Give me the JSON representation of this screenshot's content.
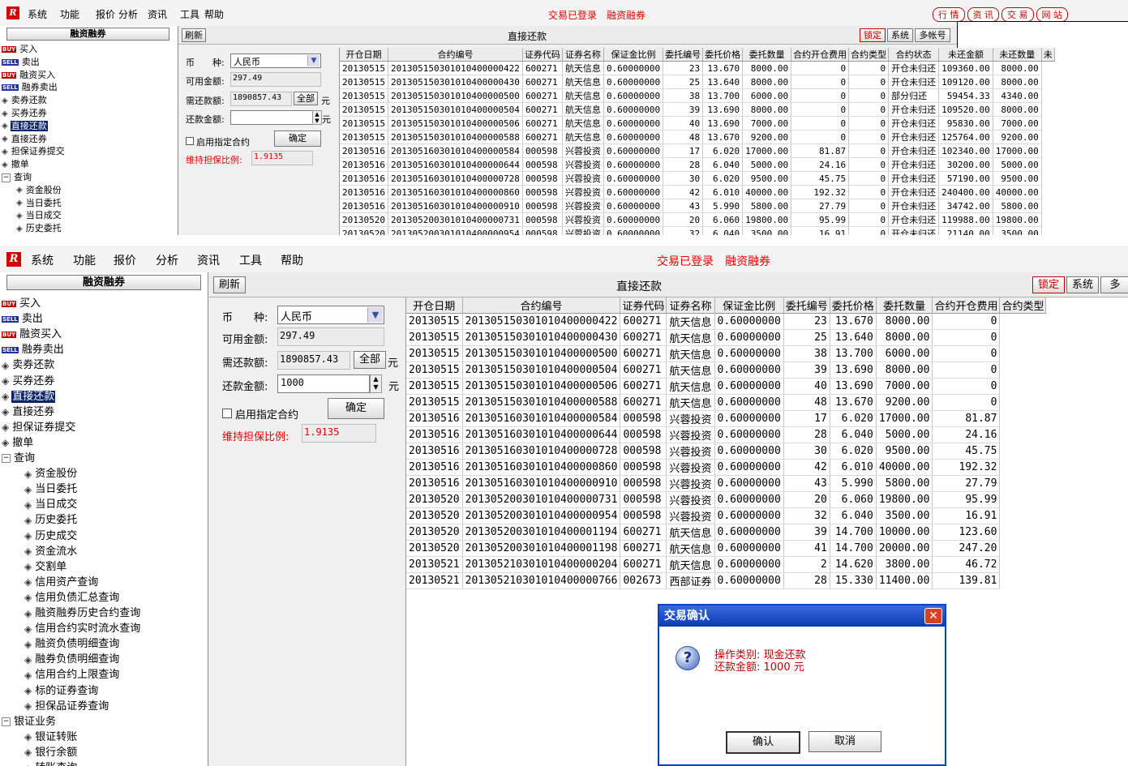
{
  "menu": {
    "logo": "R",
    "items": [
      "系统",
      "功能",
      "报价",
      "分析",
      "资讯",
      "工具",
      "帮助"
    ],
    "status": "交易已登录　融资融券",
    "top_buttons": [
      "行 情",
      "资 讯",
      "交 易",
      "网 站"
    ]
  },
  "sidebar": {
    "title": "融资融券",
    "items": [
      {
        "icon": "buy-icon",
        "badge": "BUY",
        "label": "买入"
      },
      {
        "icon": "sell-icon",
        "badge": "SELL",
        "label": "卖出"
      },
      {
        "icon": "buy-icon",
        "badge": "BUY",
        "label": "融资买入"
      },
      {
        "icon": "sell-icon",
        "badge": "SELL",
        "label": "融券卖出"
      },
      {
        "icon": "diamond-icon",
        "label": "卖券还款"
      },
      {
        "icon": "diamond-icon",
        "label": "买券还券"
      },
      {
        "icon": "diamond-icon",
        "label": "直接还款",
        "selected": true
      },
      {
        "icon": "diamond-icon",
        "label": "直接还券"
      },
      {
        "icon": "diamond-icon",
        "label": "担保证券提交"
      },
      {
        "icon": "diamond-icon",
        "label": "撤单"
      },
      {
        "icon": "collapse-icon",
        "label": "查询",
        "expander": "−"
      },
      {
        "icon": "diamond-icon",
        "label": "资金股份",
        "indent": true
      },
      {
        "icon": "diamond-icon",
        "label": "当日委托",
        "indent": true
      },
      {
        "icon": "diamond-icon",
        "label": "当日成交",
        "indent": true
      },
      {
        "icon": "diamond-icon",
        "label": "历史委托",
        "indent": true
      },
      {
        "icon": "diamond-icon",
        "label": "历史成交",
        "indent": true
      },
      {
        "icon": "diamond-icon",
        "label": "资金流水",
        "indent": true
      },
      {
        "icon": "diamond-icon",
        "label": "交割单",
        "indent": true
      },
      {
        "icon": "diamond-icon",
        "label": "信用资产查询",
        "indent": true
      },
      {
        "icon": "diamond-icon",
        "label": "信用负债汇总查询",
        "indent": true
      },
      {
        "icon": "diamond-icon",
        "label": "融资融券历史合约查询",
        "indent": true
      },
      {
        "icon": "diamond-icon",
        "label": "信用合约实时流水查询",
        "indent": true
      },
      {
        "icon": "diamond-icon",
        "label": "融资负债明细查询",
        "indent": true
      },
      {
        "icon": "diamond-icon",
        "label": "融券负债明细查询",
        "indent": true
      },
      {
        "icon": "diamond-icon",
        "label": "信用合约上限查询",
        "indent": true
      },
      {
        "icon": "diamond-icon",
        "label": "标的证券查询",
        "indent": true
      },
      {
        "icon": "diamond-icon",
        "label": "担保品证券查询",
        "indent": true
      },
      {
        "icon": "collapse-icon",
        "label": "银证业务",
        "expander": "−"
      },
      {
        "icon": "diamond-icon",
        "label": "银证转账",
        "indent": true
      },
      {
        "icon": "diamond-icon",
        "label": "银行余额",
        "indent": true
      },
      {
        "icon": "diamond-icon",
        "label": "转账查询",
        "indent": true
      }
    ]
  },
  "toolbar": {
    "refresh": "刷新",
    "title": "直接还款",
    "right_buttons": [
      "锁定",
      "系统",
      "多帐号"
    ],
    "right_buttons_cut": [
      "锁定",
      "系统",
      "多"
    ]
  },
  "form": {
    "currency_label": "币　　种:",
    "currency_value": "人民币",
    "available_label": "可用金额:",
    "available_value": "297.49",
    "need_label": "需还款额:",
    "need_value": "1890857.43",
    "all_button": "全部",
    "unit": "元",
    "repay_label": "还款金额:",
    "repay_value_top": "",
    "repay_value_bottom": "1000",
    "specify_label": "启用指定合约",
    "confirm_button": "确定",
    "ratio_label": "维持担保比例:",
    "ratio_value": "1.9135"
  },
  "table_top": {
    "headers": [
      "开仓日期",
      "合约编号",
      "证券代码",
      "证券名称",
      "保证金比例",
      "委托编号",
      "委托价格",
      "委托数量",
      "合约开仓费用",
      "合约类型",
      "合约状态",
      "未还金额",
      "未还数量",
      "未"
    ],
    "rows": [
      [
        "20130515",
        "201305150301010400000422",
        "600271",
        "航天信息",
        "0.60000000",
        "23",
        "13.670",
        "8000.00",
        "0",
        "0",
        "开仓未归还",
        "109360.00",
        "8000.00"
      ],
      [
        "20130515",
        "201305150301010400000430",
        "600271",
        "航天信息",
        "0.60000000",
        "25",
        "13.640",
        "8000.00",
        "0",
        "0",
        "开仓未归还",
        "109120.00",
        "8000.00"
      ],
      [
        "20130515",
        "201305150301010400000500",
        "600271",
        "航天信息",
        "0.60000000",
        "38",
        "13.700",
        "6000.00",
        "0",
        "0",
        "部分归还",
        "59454.33",
        "4340.00"
      ],
      [
        "20130515",
        "201305150301010400000504",
        "600271",
        "航天信息",
        "0.60000000",
        "39",
        "13.690",
        "8000.00",
        "0",
        "0",
        "开仓未归还",
        "109520.00",
        "8000.00"
      ],
      [
        "20130515",
        "201305150301010400000506",
        "600271",
        "航天信息",
        "0.60000000",
        "40",
        "13.690",
        "7000.00",
        "0",
        "0",
        "开仓未归还",
        "95830.00",
        "7000.00"
      ],
      [
        "20130515",
        "201305150301010400000588",
        "600271",
        "航天信息",
        "0.60000000",
        "48",
        "13.670",
        "9200.00",
        "0",
        "0",
        "开仓未归还",
        "125764.00",
        "9200.00"
      ],
      [
        "20130516",
        "201305160301010400000584",
        "000598",
        "兴蓉投资",
        "0.60000000",
        "17",
        "6.020",
        "17000.00",
        "81.87",
        "0",
        "开仓未归还",
        "102340.00",
        "17000.00"
      ],
      [
        "20130516",
        "201305160301010400000644",
        "000598",
        "兴蓉投资",
        "0.60000000",
        "28",
        "6.040",
        "5000.00",
        "24.16",
        "0",
        "开仓未归还",
        "30200.00",
        "5000.00"
      ],
      [
        "20130516",
        "201305160301010400000728",
        "000598",
        "兴蓉投资",
        "0.60000000",
        "30",
        "6.020",
        "9500.00",
        "45.75",
        "0",
        "开仓未归还",
        "57190.00",
        "9500.00"
      ],
      [
        "20130516",
        "201305160301010400000860",
        "000598",
        "兴蓉投资",
        "0.60000000",
        "42",
        "6.010",
        "40000.00",
        "192.32",
        "0",
        "开仓未归还",
        "240400.00",
        "40000.00"
      ],
      [
        "20130516",
        "201305160301010400000910",
        "000598",
        "兴蓉投资",
        "0.60000000",
        "43",
        "5.990",
        "5800.00",
        "27.79",
        "0",
        "开仓未归还",
        "34742.00",
        "5800.00"
      ],
      [
        "20130520",
        "201305200301010400000731",
        "000598",
        "兴蓉投资",
        "0.60000000",
        "20",
        "6.060",
        "19800.00",
        "95.99",
        "0",
        "开仓未归还",
        "119988.00",
        "19800.00"
      ],
      [
        "20130520",
        "201305200301010400000954",
        "000598",
        "兴蓉投资",
        "0.60000000",
        "32",
        "6.040",
        "3500.00",
        "16.91",
        "0",
        "开仓未归还",
        "21140.00",
        "3500.00"
      ]
    ]
  },
  "table_bottom": {
    "headers": [
      "开仓日期",
      "合约编号",
      "证券代码",
      "证券名称",
      "保证金比例",
      "委托编号",
      "委托价格",
      "委托数量",
      "合约开仓费用",
      "合约类型"
    ],
    "rows": [
      [
        "20130515",
        "201305150301010400000422",
        "600271",
        "航天信息",
        "0.60000000",
        "23",
        "13.670",
        "8000.00",
        "0"
      ],
      [
        "20130515",
        "201305150301010400000430",
        "600271",
        "航天信息",
        "0.60000000",
        "25",
        "13.640",
        "8000.00",
        "0"
      ],
      [
        "20130515",
        "201305150301010400000500",
        "600271",
        "航天信息",
        "0.60000000",
        "38",
        "13.700",
        "6000.00",
        "0"
      ],
      [
        "20130515",
        "201305150301010400000504",
        "600271",
        "航天信息",
        "0.60000000",
        "39",
        "13.690",
        "8000.00",
        "0"
      ],
      [
        "20130515",
        "201305150301010400000506",
        "600271",
        "航天信息",
        "0.60000000",
        "40",
        "13.690",
        "7000.00",
        "0"
      ],
      [
        "20130515",
        "201305150301010400000588",
        "600271",
        "航天信息",
        "0.60000000",
        "48",
        "13.670",
        "9200.00",
        "0"
      ],
      [
        "20130516",
        "201305160301010400000584",
        "000598",
        "兴蓉投资",
        "0.60000000",
        "17",
        "6.020",
        "17000.00",
        "81.87"
      ],
      [
        "20130516",
        "201305160301010400000644",
        "000598",
        "兴蓉投资",
        "0.60000000",
        "28",
        "6.040",
        "5000.00",
        "24.16"
      ],
      [
        "20130516",
        "201305160301010400000728",
        "000598",
        "兴蓉投资",
        "0.60000000",
        "30",
        "6.020",
        "9500.00",
        "45.75"
      ],
      [
        "20130516",
        "201305160301010400000860",
        "000598",
        "兴蓉投资",
        "0.60000000",
        "42",
        "6.010",
        "40000.00",
        "192.32"
      ],
      [
        "20130516",
        "201305160301010400000910",
        "000598",
        "兴蓉投资",
        "0.60000000",
        "43",
        "5.990",
        "5800.00",
        "27.79"
      ],
      [
        "20130520",
        "201305200301010400000731",
        "000598",
        "兴蓉投资",
        "0.60000000",
        "20",
        "6.060",
        "19800.00",
        "95.99"
      ],
      [
        "20130520",
        "201305200301010400000954",
        "000598",
        "兴蓉投资",
        "0.60000000",
        "32",
        "6.040",
        "3500.00",
        "16.91"
      ],
      [
        "20130520",
        "201305200301010400001194",
        "600271",
        "航天信息",
        "0.60000000",
        "39",
        "14.700",
        "10000.00",
        "123.60"
      ],
      [
        "20130520",
        "201305200301010400001198",
        "600271",
        "航天信息",
        "0.60000000",
        "41",
        "14.700",
        "20000.00",
        "247.20"
      ],
      [
        "20130521",
        "201305210301010400000204",
        "600271",
        "航天信息",
        "0.60000000",
        "2",
        "14.620",
        "3800.00",
        "46.72"
      ],
      [
        "20130521",
        "201305210301010400000766",
        "002673",
        "西部证券",
        "0.60000000",
        "28",
        "15.330",
        "11400.00",
        "139.81"
      ]
    ]
  },
  "dialog": {
    "title": "交易确认",
    "line1": "操作类别: 现金还款",
    "line2": "还款金额: 1000 元",
    "ok": "确认",
    "cancel": "取消"
  },
  "colors": {
    "accent_red": "#e00000",
    "selection": "#0a246a",
    "dialog_blue": "#0a3ab8"
  }
}
